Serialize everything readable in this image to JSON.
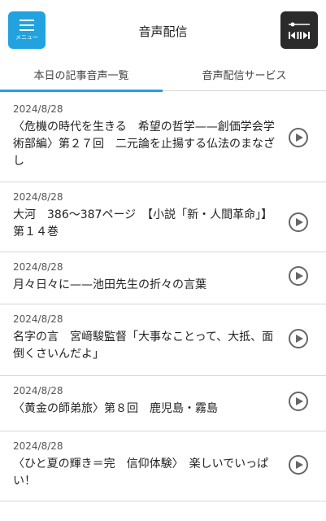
{
  "header": {
    "menu_label": "メニュー",
    "title": "音声配信",
    "player_icon": "audio-player-icon",
    "accent_color": "#22a3e0"
  },
  "tabs": [
    {
      "label": "本日の記事音声一覧",
      "active": true
    },
    {
      "label": "音声配信サービス",
      "active": false
    }
  ],
  "articles": [
    {
      "date": "2024/8/28",
      "title": "〈危機の時代を生きる　希望の哲学——創価学会学術部編〉第２７回　二元論を止揚する仏法のまなざし"
    },
    {
      "date": "2024/8/28",
      "title": "大河　386〜387ページ　【小説「新・人間革命」】第１４巻"
    },
    {
      "date": "2024/8/28",
      "title": "月々日々に——池田先生の折々の言葉"
    },
    {
      "date": "2024/8/28",
      "title": "名字の言　宮﨑駿監督「大事なことって、大抵、面倒くさいんだよ」"
    },
    {
      "date": "2024/8/28",
      "title": "〈黄金の師弟旅〉第８回　鹿児島・霧島"
    },
    {
      "date": "2024/8/28",
      "title": "〈ひと夏の輝き＝完　信仰体験〉　楽しいでいっぱい！"
    }
  ]
}
